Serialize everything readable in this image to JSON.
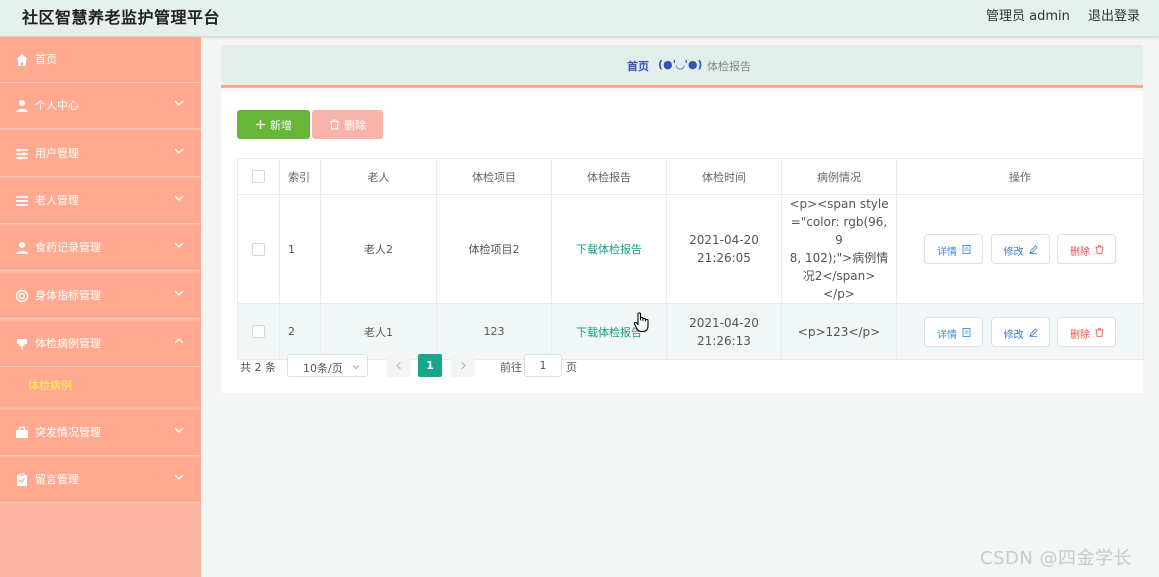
{
  "header": {
    "app_title": "社区智慧养老监护管理平台",
    "admin": "管理员 admin",
    "logout": "退出登录"
  },
  "sidebar": {
    "items": [
      {
        "label": "首页",
        "icon": "home-icon"
      },
      {
        "label": "个人中心",
        "icon": "user-icon"
      },
      {
        "label": "用户管理",
        "icon": "sliders-icon"
      },
      {
        "label": "老人管理",
        "icon": "list-icon"
      },
      {
        "label": "食药记录管理",
        "icon": "user-icon"
      },
      {
        "label": "身体指标管理",
        "icon": "target-icon"
      },
      {
        "label": "体检病例管理",
        "icon": "pin-icon"
      },
      {
        "label": "突发情况管理",
        "icon": "briefcase-icon"
      },
      {
        "label": "留言管理",
        "icon": "clipboard-icon"
      }
    ],
    "active_sub": "体检病例"
  },
  "breadcrumb": {
    "home": "首页",
    "separator": "(●'◡'●)",
    "current": "体检报告"
  },
  "toolbar": {
    "add_label": "新增",
    "delete_label": "删除"
  },
  "table": {
    "headers": [
      "索引",
      "老人",
      "体检项目",
      "体检报告",
      "体检时间",
      "病例情况",
      "操作"
    ],
    "rows": [
      {
        "index": "1",
        "elder": "老人2",
        "item": "体检项目2",
        "report": "下载体检报告",
        "time": "2021-04-20 21:26:05",
        "case_lines": [
          "<p><span style",
          "=\"color: rgb(96, 9",
          "8, 102);\">病例情",
          "况2</span></p>"
        ]
      },
      {
        "index": "2",
        "elder": "老人1",
        "item": "123",
        "report": "下载体检报告",
        "time": "2021-04-20 21:26:13",
        "case_lines": [
          "<p>123</p>"
        ]
      }
    ],
    "actions": {
      "detail": "详情",
      "edit": "修改",
      "delete": "删除"
    }
  },
  "pagination": {
    "total": "共 2 条",
    "page_size": "10条/页",
    "current_page": "1",
    "goto_label": "前往",
    "goto_value": "1",
    "page_unit": "页"
  },
  "watermark": "CSDN @四金学长",
  "colors": {
    "sidebar_bg": "#ffaa90",
    "submenu_active": "#ffee58",
    "add_button": "#67b639",
    "delete_button_disabled": "#f8b3ab",
    "link_green": "#16a085",
    "page_active": "#1aa68a"
  }
}
